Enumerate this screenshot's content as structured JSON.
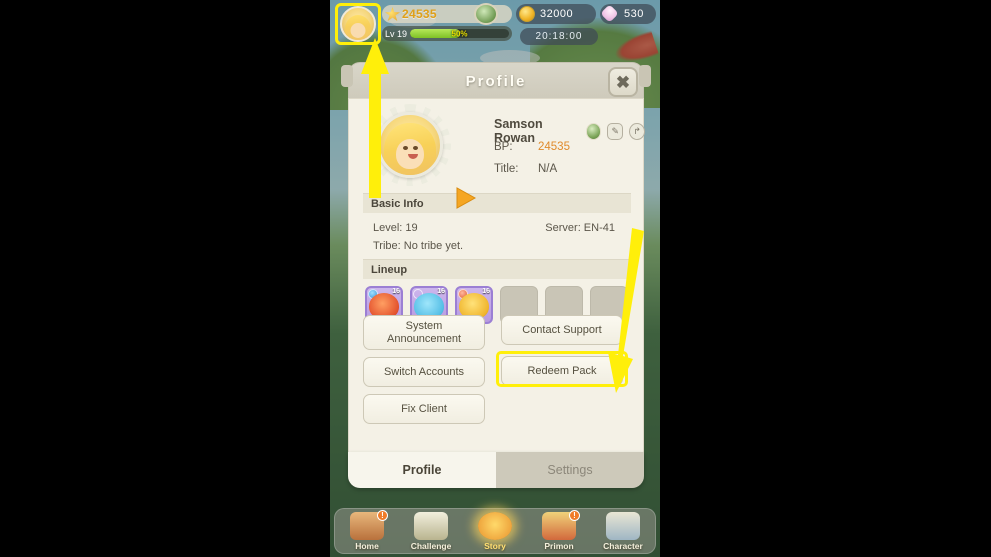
{
  "hud": {
    "bp_value": "24535",
    "level_text": "Lv 19",
    "level_percent": "50%",
    "gold": "32000",
    "gems": "530",
    "timer": "20:18:00"
  },
  "dialog": {
    "title": "Profile",
    "close_label": "✖",
    "identity": {
      "name": "Samson Rowan",
      "bp_label": "BP:",
      "bp_value": "24535",
      "title_label": "Title:",
      "title_value": "N/A",
      "edit_icon": "✎",
      "share_icon": "↱"
    },
    "basic_info": {
      "heading": "Basic Info",
      "level_label": "Level: 19",
      "server_label": "Server: EN-41",
      "tribe_label": "Tribe: No tribe yet."
    },
    "lineup": {
      "heading": "Lineup",
      "units": [
        {
          "level": "16"
        },
        {
          "level": "16"
        },
        {
          "level": "16"
        }
      ],
      "empty_slots": 3
    },
    "actions": {
      "system_announcement": "System Announcement",
      "switch_accounts": "Switch Accounts",
      "fix_client": "Fix Client",
      "contact_support": "Contact Support",
      "redeem_pack": "Redeem Pack"
    },
    "tabs": {
      "profile": "Profile",
      "settings": "Settings"
    }
  },
  "bottom_nav": [
    {
      "label": "Home",
      "badge": "!"
    },
    {
      "label": "Challenge",
      "badge": ""
    },
    {
      "label": "Story",
      "badge": ""
    },
    {
      "label": "Primon",
      "badge": "!"
    },
    {
      "label": "Character",
      "badge": ""
    }
  ],
  "colors": {
    "highlight": "#ffef0a",
    "accent_bp": "#e08a2a",
    "panel_bg": "#f4f1e6"
  }
}
